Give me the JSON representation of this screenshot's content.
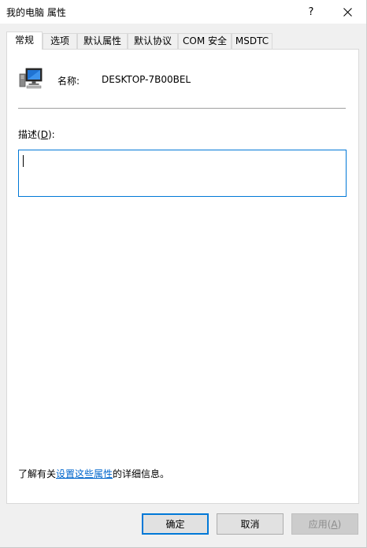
{
  "window": {
    "title": "我的电脑 属性",
    "help_symbol": "?"
  },
  "tabs": [
    {
      "label": "常规",
      "active": true
    },
    {
      "label": "选项"
    },
    {
      "label": "默认属性"
    },
    {
      "label": "默认协议"
    },
    {
      "label": "COM 安全"
    },
    {
      "label": "MSDTC"
    }
  ],
  "general": {
    "name_label": "名称:",
    "name_value": "DESKTOP-7B00BEL",
    "description_label_prefix": "描述(",
    "description_label_key": "D",
    "description_label_suffix": "):",
    "description_value": "",
    "info_prefix": "了解有关",
    "info_link": "设置这些属性",
    "info_suffix": "的详细信息。"
  },
  "buttons": {
    "ok": "确定",
    "cancel": "取消",
    "apply_prefix": "应用(",
    "apply_key": "A",
    "apply_suffix": ")"
  },
  "colors": {
    "focus_border": "#0078d7",
    "link": "#0066cc",
    "disabled_text": "#8c8c8c"
  },
  "icons": {
    "computer": "computer-icon",
    "close": "close-icon"
  }
}
